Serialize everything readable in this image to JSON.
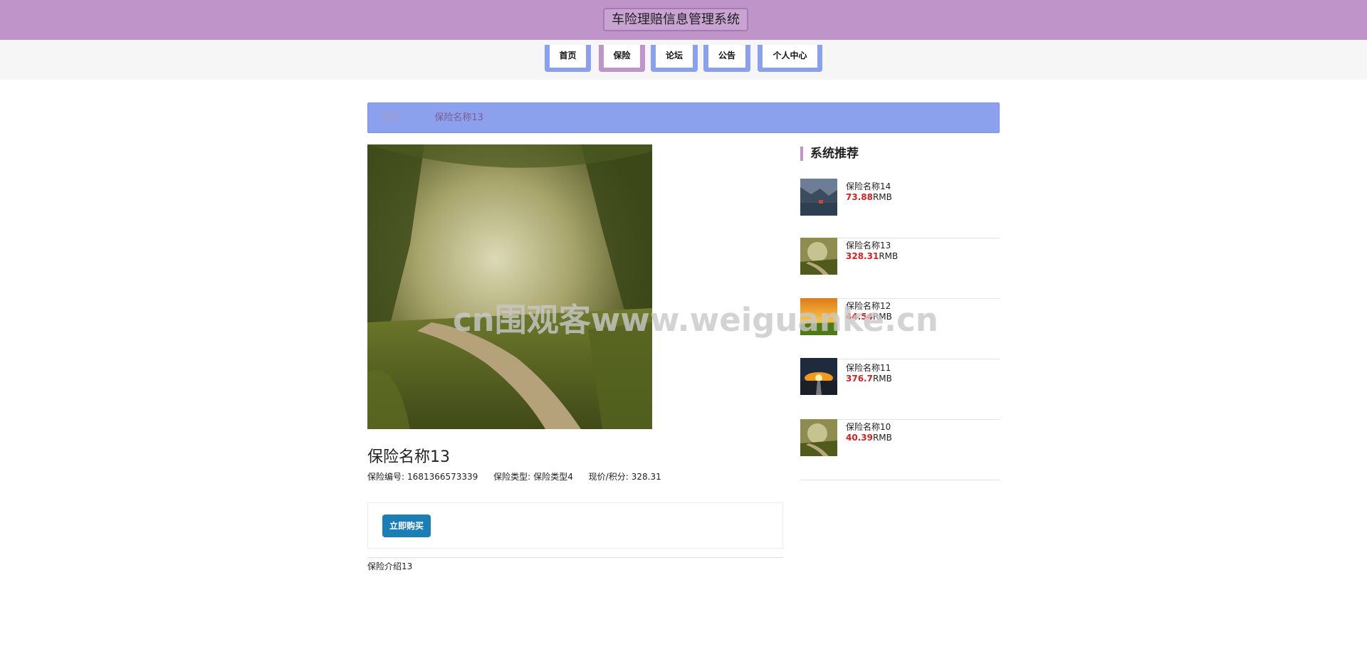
{
  "header": {
    "title": "车险理赔信息管理系统"
  },
  "nav": {
    "items": [
      {
        "label": "首页"
      },
      {
        "label": "保险"
      },
      {
        "label": "论坛"
      },
      {
        "label": "公告"
      },
      {
        "label": "个人中心"
      }
    ],
    "active_index": 1
  },
  "breadcrumb": {
    "home": "首页",
    "separator": "/",
    "current": "保险名称13"
  },
  "product": {
    "title": "保险名称13",
    "meta": {
      "code_label": "保险编号:",
      "code_value": "1681366573339",
      "type_label": "保险类型:",
      "type_value": "保险类型4",
      "price_label": "现价/积分:",
      "price_value": "328.31"
    },
    "buy_label": "立即购买",
    "intro": "保险介绍13"
  },
  "sidebar": {
    "title": "系统推荐",
    "items": [
      {
        "name": "保险名称14",
        "price": "73.88",
        "unit": "RMB"
      },
      {
        "name": "保险名称13",
        "price": "328.31",
        "unit": "RMB"
      },
      {
        "name": "保险名称12",
        "price": "44.54",
        "unit": "RMB"
      },
      {
        "name": "保险名称11",
        "price": "376.7",
        "unit": "RMB"
      },
      {
        "name": "保险名称10",
        "price": "40.39",
        "unit": "RMB"
      }
    ]
  },
  "watermark": "cn围观客www.weiguanke.cn",
  "colors": {
    "header": "#bf95c9",
    "nav_border": "#8ba1ee",
    "breadcrumb": "#8ba1ee",
    "buy_button": "#1b7fb5",
    "price": "#d22222"
  }
}
